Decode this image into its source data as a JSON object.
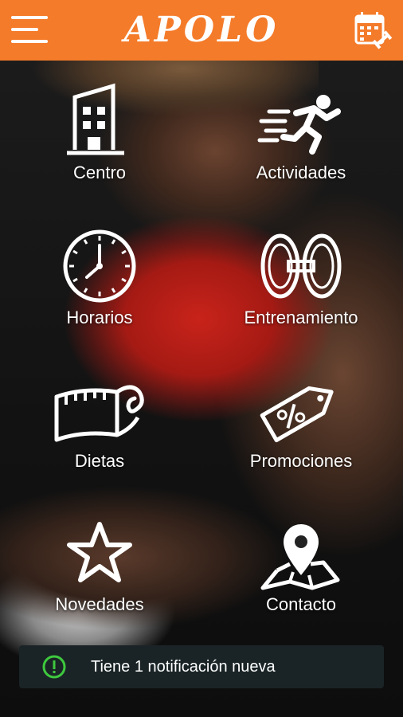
{
  "topbar": {
    "background_color": "#f47b2a",
    "menu_icon": "hamburger-menu-icon",
    "logo_text": "APOLO",
    "calendar_icon": "calendar-icon"
  },
  "menu": {
    "items": [
      {
        "label": "Centro",
        "icon": "building-icon"
      },
      {
        "label": "Actividades",
        "icon": "running-person-icon"
      },
      {
        "label": "Horarios",
        "icon": "clock-icon"
      },
      {
        "label": "Entrenamiento",
        "icon": "dumbbell-icon"
      },
      {
        "label": "Dietas",
        "icon": "measuring-tape-icon"
      },
      {
        "label": "Promociones",
        "icon": "percent-tag-icon"
      },
      {
        "label": "Novedades",
        "icon": "star-icon"
      },
      {
        "label": "Contacto",
        "icon": "map-pin-icon"
      }
    ]
  },
  "notification": {
    "icon": "alert-circle-icon",
    "icon_color": "#3ec83e",
    "text": "Tiene 1 notificación nueva"
  }
}
